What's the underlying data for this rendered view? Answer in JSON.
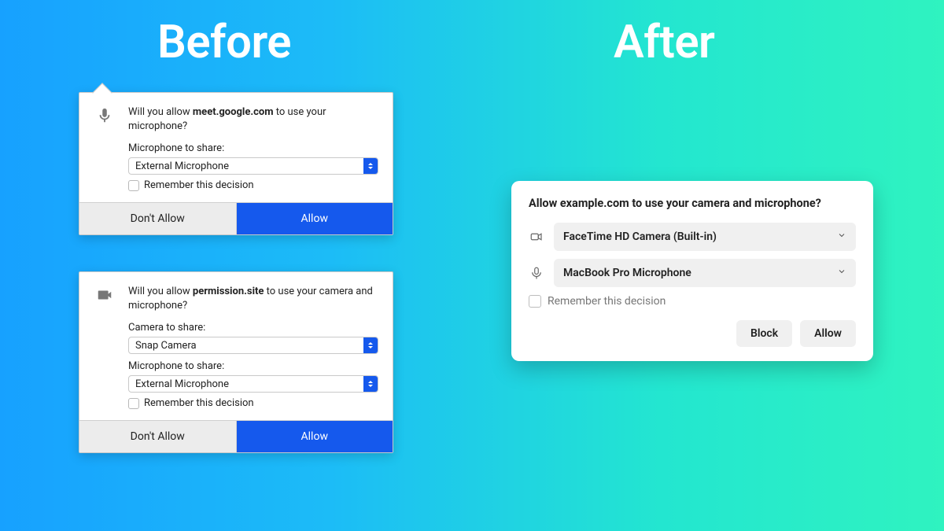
{
  "headings": {
    "before": "Before",
    "after": "After"
  },
  "before": {
    "panel1": {
      "msg_pre": "Will you allow ",
      "msg_domain": "meet.google.com",
      "msg_post": " to use your microphone?",
      "mic_label": "Microphone to share:",
      "mic_value": "External Microphone",
      "remember": "Remember this decision",
      "deny": "Don't Allow",
      "allow": "Allow"
    },
    "panel2": {
      "msg_pre": "Will you allow ",
      "msg_domain": "permission.site",
      "msg_post": " to use your camera and microphone?",
      "cam_label": "Camera to share:",
      "cam_value": "Snap Camera",
      "mic_label": "Microphone to share:",
      "mic_value": "External Microphone",
      "remember": "Remember this decision",
      "deny": "Don't Allow",
      "allow": "Allow"
    }
  },
  "after": {
    "title": "Allow example.com to use your camera and microphone?",
    "camera_value": "FaceTime HD Camera (Built-in)",
    "mic_value": "MacBook Pro Microphone",
    "remember": "Remember this decision",
    "block": "Block",
    "allow": "Allow"
  }
}
